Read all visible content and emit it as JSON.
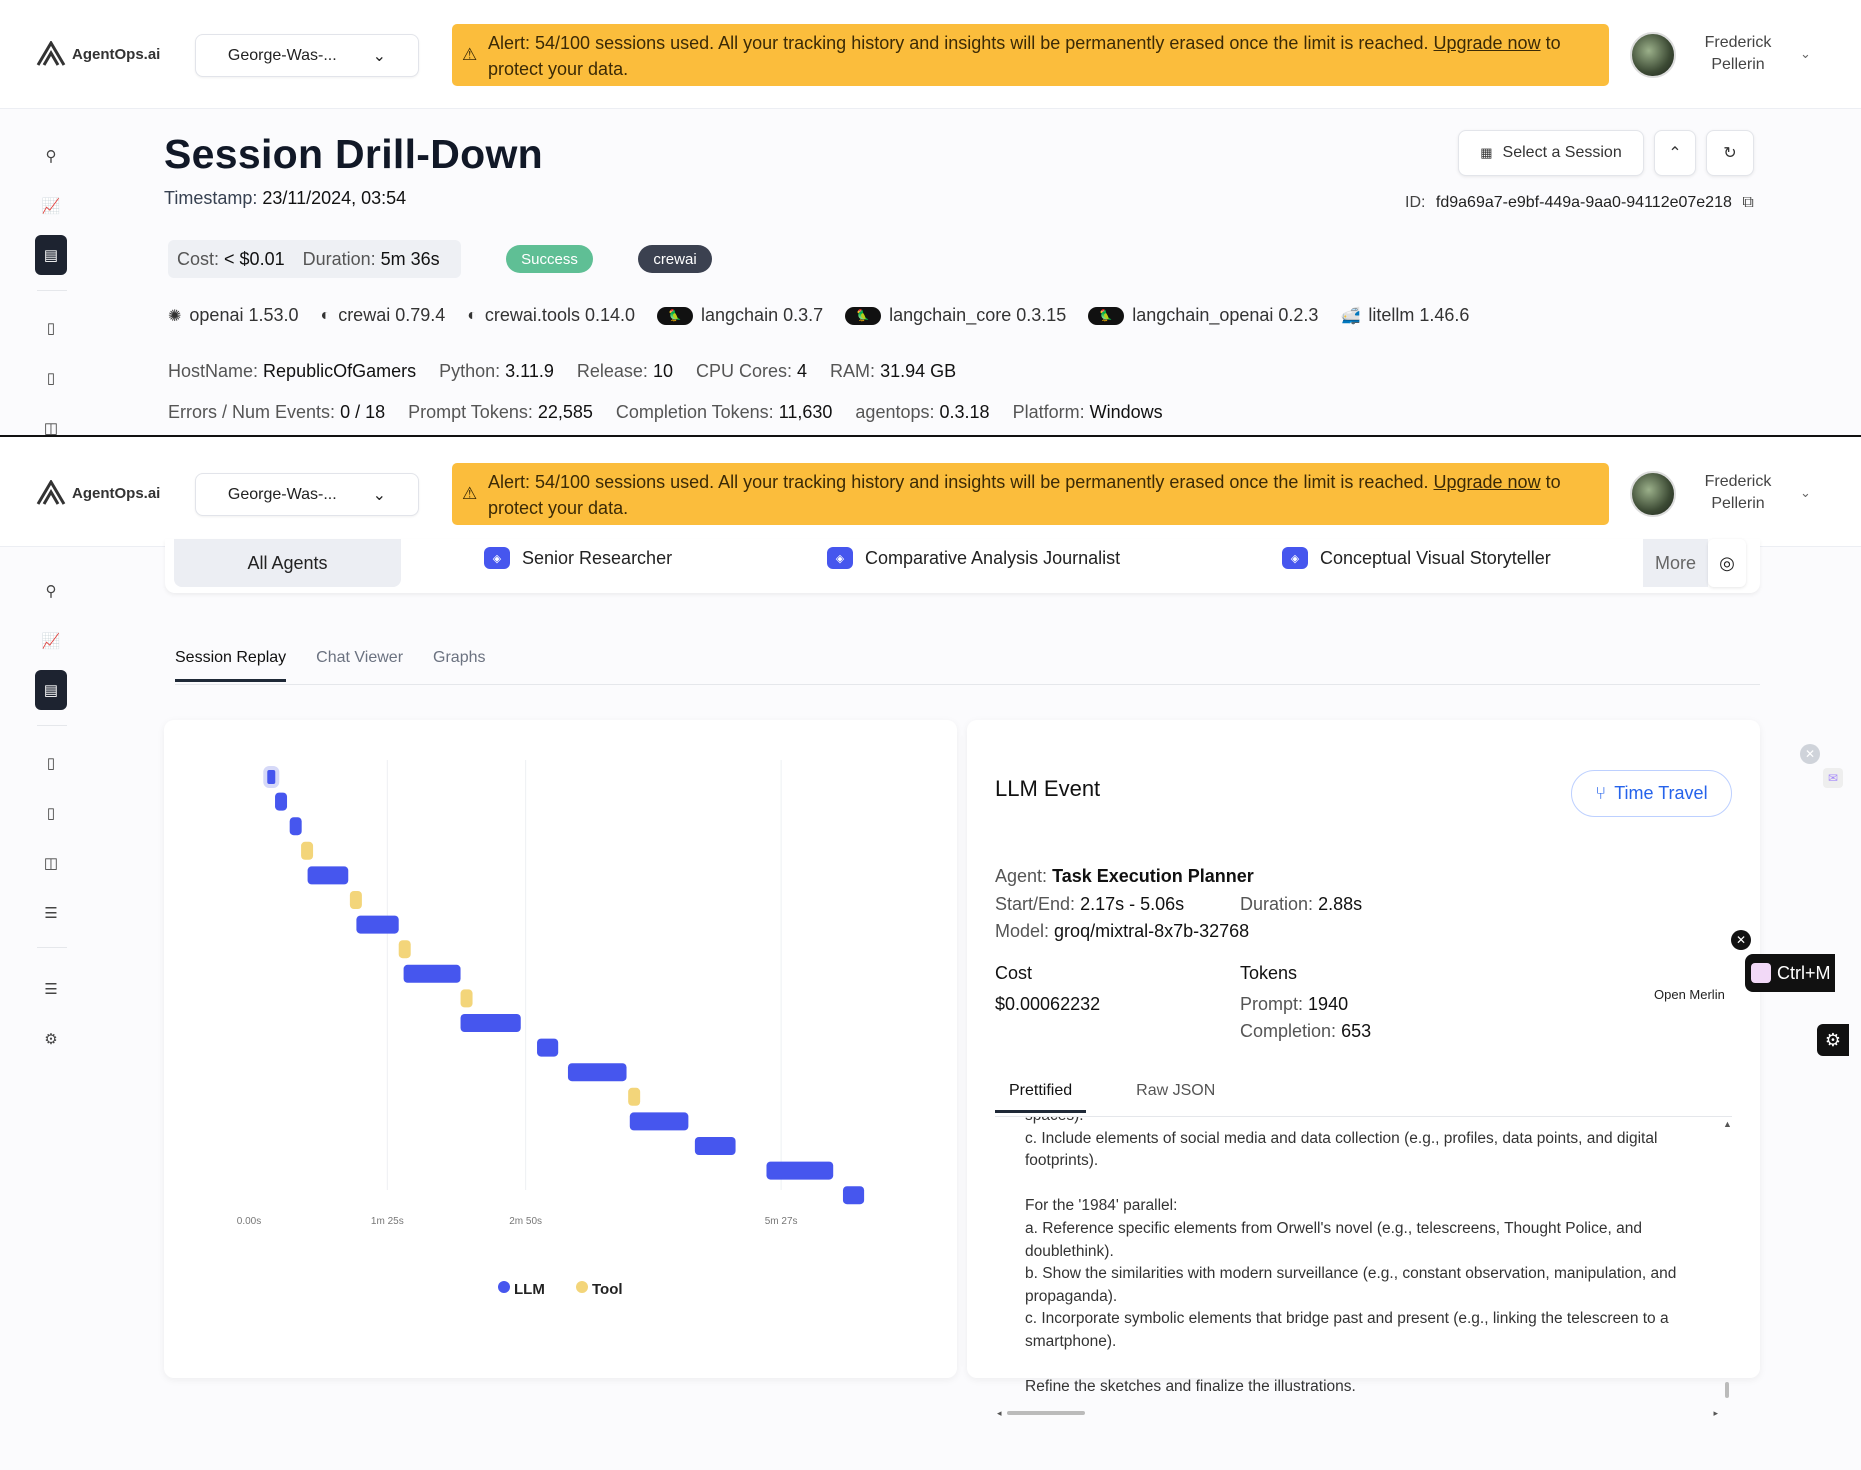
{
  "header": {
    "logo_text": "AgentOps.ai",
    "project": "George-Was-...",
    "alert_text": "Alert: 54/100 sessions used. All your tracking history and insights will be permanently erased once the limit is reached.",
    "alert_link": "Upgrade now",
    "alert_tail": "to protect your data.",
    "user_first": "Frederick",
    "user_last": "Pellerin"
  },
  "session": {
    "title": "Session Drill-Down",
    "timestamp_label": "Timestamp:",
    "timestamp": "23/11/2024, 03:54",
    "select_label": "Select a Session",
    "id_label": "ID:",
    "id": "fd9a69a7-e9bf-449a-9aa0-94112e07e218",
    "cost_label": "Cost:",
    "cost": "< $0.01",
    "duration_label": "Duration:",
    "duration": "5m 36s",
    "status": "Success",
    "tag": "crewai",
    "libs": [
      {
        "name": "openai 1.53.0"
      },
      {
        "name": "crewai 0.79.4"
      },
      {
        "name": "crewai.tools 0.14.0"
      },
      {
        "name": "langchain 0.3.7"
      },
      {
        "name": "langchain_core 0.3.15"
      },
      {
        "name": "langchain_openai 0.2.3"
      },
      {
        "name": "litellm 1.46.6"
      }
    ],
    "hostname_label": "HostName:",
    "hostname": "RepublicOfGamers",
    "python_label": "Python:",
    "python": "3.11.9",
    "release_label": "Release:",
    "release": "10",
    "cpu_label": "CPU Cores:",
    "cpu": "4",
    "ram_label": "RAM:",
    "ram": "31.94 GB",
    "errors_label": "Errors / Num Events:",
    "errors": "0 / 18",
    "prompt_tokens_label": "Prompt Tokens:",
    "prompt_tokens": "22,585",
    "completion_tokens_label": "Completion Tokens:",
    "completion_tokens": "11,630",
    "agentops_label": "agentops:",
    "agentops": "0.3.18",
    "platform_label": "Platform:",
    "platform": "Windows"
  },
  "agents": {
    "items": [
      "All Agents",
      "Senior Researcher",
      "Comparative Analysis Journalist",
      "Conceptual Visual Storyteller"
    ],
    "more": "More"
  },
  "tabs": [
    "Session Replay",
    "Chat Viewer",
    "Graphs"
  ],
  "chart_data": {
    "type": "gantt",
    "x_ticks": [
      "0.00s",
      "1m 25s",
      "2m 50s",
      "5m 27s"
    ],
    "legend": [
      {
        "name": "LLM",
        "color": "#4656ee"
      },
      {
        "name": "Tool",
        "color": "#f3d57a"
      }
    ],
    "events": [
      {
        "type": "LLM",
        "start": 10,
        "end": 12
      },
      {
        "type": "LLM",
        "start": 16,
        "end": 23
      },
      {
        "type": "LLM",
        "start": 25,
        "end": 32
      },
      {
        "type": "Tool",
        "start": 32,
        "end": 38
      },
      {
        "type": "LLM",
        "start": 36,
        "end": 61
      },
      {
        "type": "Tool",
        "start": 62,
        "end": 69
      },
      {
        "type": "LLM",
        "start": 66,
        "end": 92
      },
      {
        "type": "Tool",
        "start": 92,
        "end": 99
      },
      {
        "type": "LLM",
        "start": 95,
        "end": 130
      },
      {
        "type": "Tool",
        "start": 130,
        "end": 137
      },
      {
        "type": "LLM",
        "start": 130,
        "end": 167
      },
      {
        "type": "LLM",
        "start": 177,
        "end": 190
      },
      {
        "type": "LLM",
        "start": 196,
        "end": 232
      },
      {
        "type": "Tool",
        "start": 233,
        "end": 240
      },
      {
        "type": "LLM",
        "start": 234,
        "end": 270
      },
      {
        "type": "LLM",
        "start": 274,
        "end": 299
      },
      {
        "type": "LLM",
        "start": 318,
        "end": 359
      },
      {
        "type": "LLM",
        "start": 365,
        "end": 378
      }
    ],
    "x_max_seconds": 381
  },
  "event": {
    "title": "LLM Event",
    "time_travel": "Time Travel",
    "agent_label": "Agent:",
    "agent": "Task Execution Planner",
    "startend_label": "Start/End:",
    "startend": "2.17s - 5.06s",
    "duration_label": "Duration:",
    "duration": "2.88s",
    "model_label": "Model:",
    "model": "groq/mixtral-8x7b-32768",
    "cost_label": "Cost",
    "cost": "$0.00062232",
    "tokens_label": "Tokens",
    "prompt_label": "Prompt:",
    "prompt": "1940",
    "completion_label": "Completion:",
    "completion": "653",
    "subtabs": [
      "Prettified",
      "Raw JSON"
    ],
    "body": "spaces).\nc. Include elements of social media and data collection (e.g., profiles, data points, and digital footprints).\n\nFor the '1984' parallel:\na. Reference specific elements from Orwell's novel (e.g., telescreens, Thought Police, and doublethink).\nb. Show the similarities with modern surveillance (e.g., constant observation, manipulation, and propaganda).\nc. Incorporate symbolic elements that bridge past and present (e.g., linking the telescreen to a smartphone).\n\nRefine the sketches and finalize the illustrations."
  },
  "merlin": {
    "shortcut": "Ctrl+M",
    "label": "Open Merlin"
  },
  "colors": {
    "alert": "#fbbd3c",
    "success": "#5fbf95",
    "llm": "#4656ee",
    "tool": "#f3d57a",
    "accent": "#2563eb"
  }
}
